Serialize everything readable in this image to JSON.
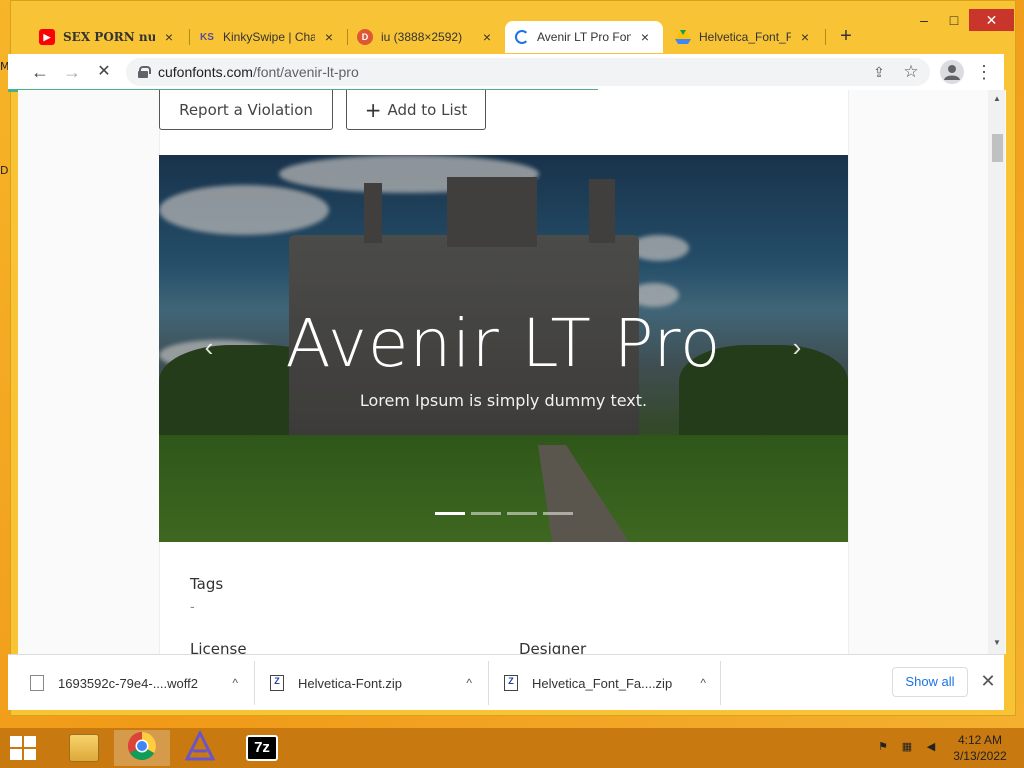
{
  "desktop": {
    "side_labels": [
      "M",
      "D"
    ]
  },
  "browser": {
    "tabs": [
      {
        "title": "SEX PORN nude",
        "favicon": "youtube-icon",
        "close": "×"
      },
      {
        "title": "KinkySwipe | Chat",
        "favicon": "ks-icon",
        "close": "×"
      },
      {
        "title": "iu (3888×2592)",
        "favicon": "duckduckgo-icon",
        "close": "×"
      },
      {
        "title": "Avenir LT Pro Fon",
        "favicon": "loading-icon",
        "close": "×",
        "active": true
      },
      {
        "title": "Helvetica_Font_Fa",
        "favicon": "google-drive-icon",
        "close": "×"
      }
    ],
    "new_tab": "+",
    "window_controls": {
      "minimize": "–",
      "maximize": "□",
      "close": "✕"
    },
    "nav": {
      "back": "←",
      "forward": "→",
      "stop": "✕"
    },
    "address": {
      "domain": "cufonfonts.com",
      "path": "/font/avenir-lt-pro"
    },
    "toolbar_icons": {
      "share": "⇪",
      "bookmark": "☆",
      "menu": "⋮"
    }
  },
  "page": {
    "buttons": {
      "report": "Report a Violation",
      "add_to_list": "Add to List",
      "add_icon": "+"
    },
    "hero": {
      "title": "Avenir LT Pro",
      "subtitle": "Lorem Ipsum is simply dummy text.",
      "prev": "‹",
      "next": "›",
      "slide_count": 4,
      "active_slide": 0
    },
    "sections": {
      "tags_label": "Tags",
      "tags_value": "-",
      "license_label": "License",
      "designer_label": "Designer"
    }
  },
  "downloads": {
    "items": [
      {
        "name": "1693592c-79e4-....woff2",
        "icon": "file-icon"
      },
      {
        "name": "Helvetica-Font.zip",
        "icon": "zip-icon"
      },
      {
        "name": "Helvetica_Font_Fa....zip",
        "icon": "zip-icon"
      }
    ],
    "caret": "^",
    "show_all": "Show all",
    "close": "✕"
  },
  "taskbar": {
    "apps": [
      "file-explorer-icon",
      "chrome-icon",
      "font-app-icon",
      "7zip-icon"
    ],
    "time": "4:12 AM",
    "date": "3/13/2022",
    "seven_zip_label": "7z"
  },
  "colors": {
    "desktop": "#f5aa22",
    "taskbar": "#c8790f",
    "chrome_frame": "#f8c436",
    "accent": "#1a73e8",
    "progress": "#4caf8a"
  }
}
